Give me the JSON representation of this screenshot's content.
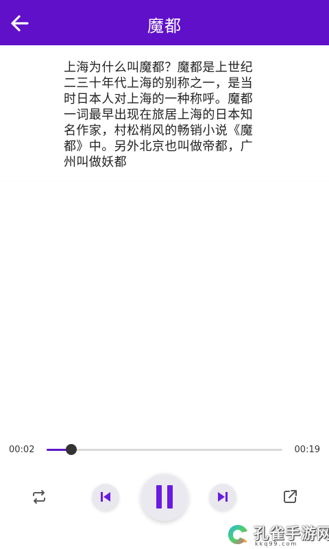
{
  "header": {
    "title": "魔都",
    "back_icon": "arrow-left-icon",
    "background_color": "#6010c9"
  },
  "article": {
    "text": "上海为什么叫魔都？魔都是上世纪二三十年代上海的别称之一，是当时日本人对上海的一种称呼。魔都一词最早出现在旅居上海的日本知名作家，村松梢风的畅销小说《魔都》中。另外北京也叫做帝都，广州叫做妖都"
  },
  "player": {
    "current_time": "00:02",
    "total_time": "00:19",
    "progress_fraction": 0.105,
    "accent_color": "#5a16c6",
    "controls": {
      "loop_icon": "repeat-icon",
      "prev_icon": "skip-previous-icon",
      "pause_icon": "pause-icon",
      "next_icon": "skip-next-icon",
      "share_icon": "share-external-icon"
    }
  },
  "watermark": {
    "text": "孔雀手游网",
    "subtext": "kkq99.com"
  }
}
